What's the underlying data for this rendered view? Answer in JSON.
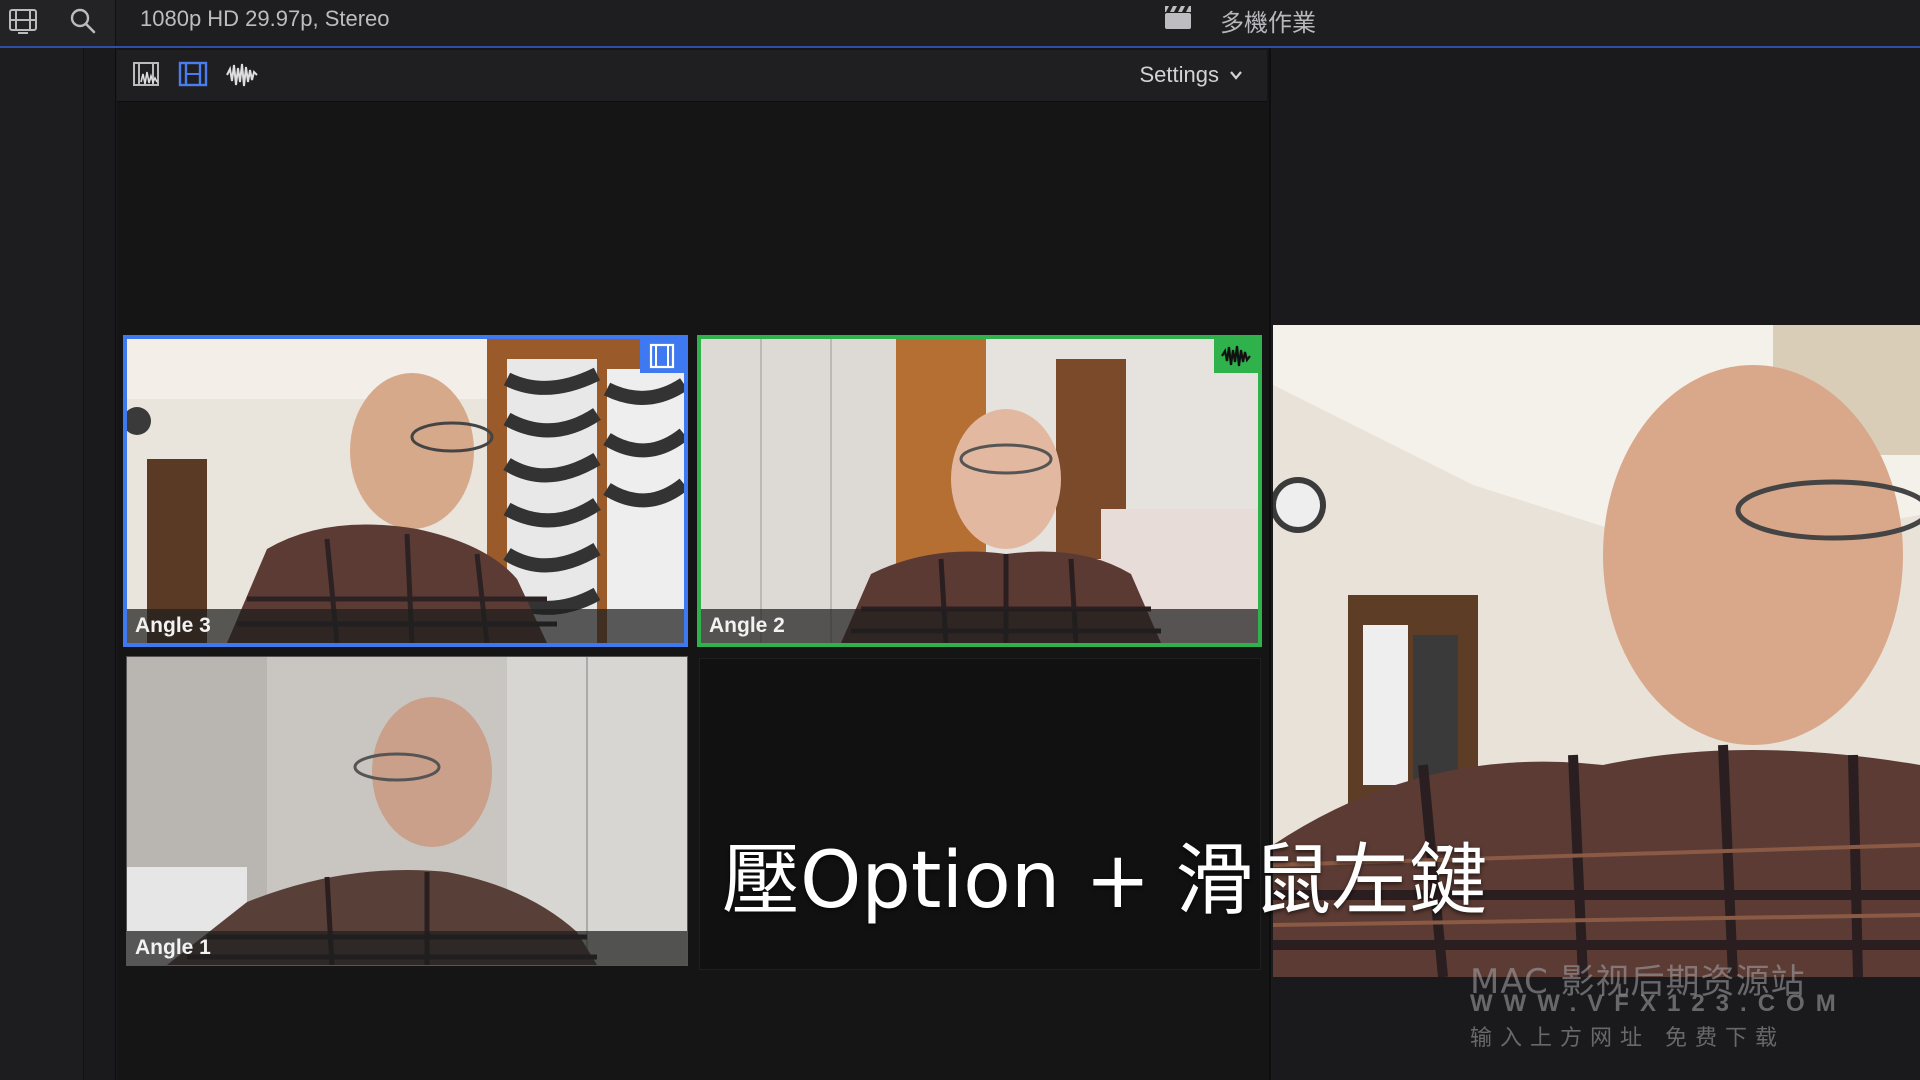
{
  "topbar": {
    "format": "1080p HD 29.97p, Stereo",
    "title": "多機作業",
    "icons": [
      "filmstrip-browser-icon",
      "search-icon",
      "clapper-icon"
    ]
  },
  "angle_toolbar": {
    "icons": [
      "video-audio-switch-icon",
      "video-only-switch-icon",
      "audio-only-switch-icon"
    ],
    "settings_label": "Settings"
  },
  "angles": [
    {
      "label": "Angle 3",
      "state": "active-video"
    },
    {
      "label": "Angle 2",
      "state": "active-audio"
    },
    {
      "label": "Angle 1",
      "state": "inactive"
    }
  ],
  "caption": "壓Option + 滑鼠左鍵",
  "watermark": {
    "line1": "MAC 影视后期资源站",
    "line2": "WWW.VFX123.COM",
    "line3": "输入上方网址 免费下载"
  },
  "colors": {
    "video_highlight": "#3f79f2",
    "audio_highlight": "#2fb24c",
    "accent_line": "#2f4fa7"
  }
}
